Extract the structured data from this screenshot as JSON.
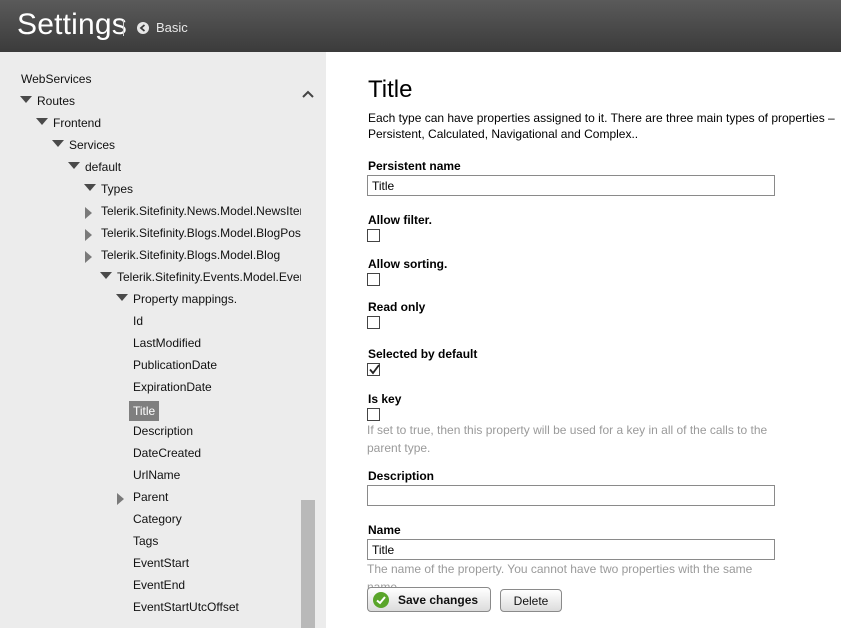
{
  "header": {
    "title": "Settings",
    "back_label": "Basic"
  },
  "tree": {
    "nodes": [
      {
        "label": "WebServices",
        "depth": 0,
        "expander": "none"
      },
      {
        "label": "Routes",
        "depth": 0,
        "expander": "expanded"
      },
      {
        "label": "Frontend",
        "depth": 1,
        "expander": "expanded"
      },
      {
        "label": "Services",
        "depth": 2,
        "expander": "expanded"
      },
      {
        "label": "default",
        "depth": 3,
        "expander": "expanded"
      },
      {
        "label": "Types",
        "depth": 4,
        "expander": "expanded"
      },
      {
        "label": "Telerik.Sitefinity.News.Model.NewsItem",
        "depth": 5,
        "expander": "collapsed"
      },
      {
        "label": "Telerik.Sitefinity.Blogs.Model.BlogPost",
        "depth": 5,
        "expander": "collapsed"
      },
      {
        "label": "Telerik.Sitefinity.Blogs.Model.Blog",
        "depth": 5,
        "expander": "collapsed"
      },
      {
        "label": "Telerik.Sitefinity.Events.Model.Event",
        "depth": 5,
        "expander": "expanded"
      },
      {
        "label": "Property mappings.",
        "depth": 6,
        "expander": "expanded"
      },
      {
        "label": "Id",
        "depth": 7,
        "expander": "none"
      },
      {
        "label": "LastModified",
        "depth": 7,
        "expander": "none"
      },
      {
        "label": "PublicationDate",
        "depth": 7,
        "expander": "none"
      },
      {
        "label": "ExpirationDate",
        "depth": 7,
        "expander": "none"
      },
      {
        "label": "Title",
        "depth": 7,
        "expander": "none",
        "selected": true
      },
      {
        "label": "Description",
        "depth": 7,
        "expander": "none"
      },
      {
        "label": "DateCreated",
        "depth": 7,
        "expander": "none"
      },
      {
        "label": "UrlName",
        "depth": 7,
        "expander": "none"
      },
      {
        "label": "Parent",
        "depth": 7,
        "expander": "collapsed"
      },
      {
        "label": "Category",
        "depth": 7,
        "expander": "none"
      },
      {
        "label": "Tags",
        "depth": 7,
        "expander": "none"
      },
      {
        "label": "EventStart",
        "depth": 7,
        "expander": "none"
      },
      {
        "label": "EventEnd",
        "depth": 7,
        "expander": "none"
      },
      {
        "label": "EventStartUtcOffset",
        "depth": 7,
        "expander": "none"
      }
    ]
  },
  "form": {
    "heading": "Title",
    "intro": "Each type can have properties assigned to it. There are three main types of properties – Persistent, Calculated, Navigational and Complex..",
    "persistent_name": {
      "label": "Persistent name",
      "value": "Title"
    },
    "allow_filter": {
      "label": "Allow filter.",
      "checked": false
    },
    "allow_sorting": {
      "label": "Allow sorting.",
      "checked": false
    },
    "read_only": {
      "label": "Read only",
      "checked": false
    },
    "selected_by_default": {
      "label": "Selected by default",
      "checked": true
    },
    "is_key": {
      "label": "Is key",
      "checked": false,
      "hint": "If set to true, then this property will be used for a key in all of the calls to the parent type."
    },
    "description": {
      "label": "Description",
      "value": ""
    },
    "name": {
      "label": "Name",
      "value": "Title",
      "hint": "The name of the property. You cannot have two properties with the same name."
    },
    "save_label": "Save changes",
    "delete_label": "Delete"
  },
  "colors": {
    "header": "#474747",
    "sidebar": "#ececec",
    "selected": "#7f7f7f",
    "save_icon": "#5aa52a"
  }
}
